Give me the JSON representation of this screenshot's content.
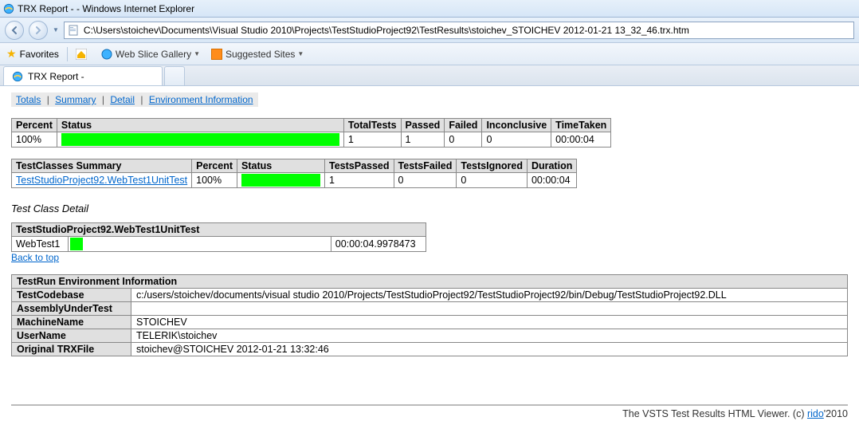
{
  "window": {
    "title": "TRX Report -  - Windows Internet Explorer",
    "url": "C:\\Users\\stoichev\\Documents\\Visual Studio 2010\\Projects\\TestStudioProject92\\TestResults\\stoichev_STOICHEV 2012-01-21 13_32_46.trx.htm",
    "favorites_label": "Favorites",
    "webslice_label": "Web Slice Gallery",
    "suggested_label": "Suggested Sites",
    "tab_title": "TRX Report -"
  },
  "nav": {
    "totals": "Totals",
    "summary": "Summary",
    "detail": "Detail",
    "env": "Environment Information"
  },
  "totals": {
    "cols": {
      "percent": "Percent",
      "status": "Status",
      "total": "TotalTests",
      "passed": "Passed",
      "failed": "Failed",
      "inconclusive": "Inconclusive",
      "time": "TimeTaken"
    },
    "row": {
      "percent": "100%",
      "total": "1",
      "passed": "1",
      "failed": "0",
      "inconclusive": "0",
      "time": "00:00:04"
    }
  },
  "summary": {
    "cols": {
      "cls": "TestClasses Summary",
      "percent": "Percent",
      "status": "Status",
      "passed": "TestsPassed",
      "failed": "TestsFailed",
      "ignored": "TestsIgnored",
      "dur": "Duration"
    },
    "row": {
      "cls": "TestStudioProject92.WebTest1UnitTest",
      "percent": "100%",
      "passed": "1",
      "failed": "0",
      "ignored": "0",
      "dur": "00:00:04"
    }
  },
  "detail": {
    "section_label": "Test Class Detail",
    "class_header": "TestStudioProject92.WebTest1UnitTest",
    "row": {
      "name": "WebTest1",
      "dur": "00:00:04.9978473"
    },
    "back": "Back to top"
  },
  "env": {
    "header": "TestRun Environment Information",
    "rows": {
      "codebase_k": "TestCodebase",
      "codebase_v": "c:/users/stoichev/documents/visual studio 2010/Projects/TestStudioProject92/TestStudioProject92/bin/Debug/TestStudioProject92.DLL",
      "asm_k": "AssemblyUnderTest",
      "asm_v": "",
      "machine_k": "MachineName",
      "machine_v": "STOICHEV",
      "user_k": "UserName",
      "user_v": "TELERIK\\stoichev",
      "trx_k": "Original TRXFile",
      "trx_v": "stoichev@STOICHEV 2012-01-21 13:32:46"
    }
  },
  "footer": {
    "text_a": "The VSTS Test Results HTML Viewer. (c) ",
    "link": "rido",
    "text_b": "'2010"
  }
}
